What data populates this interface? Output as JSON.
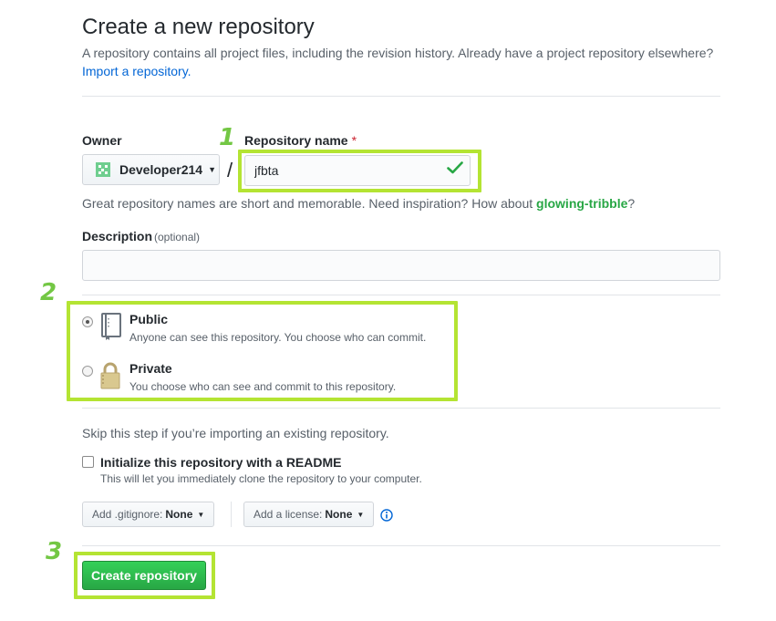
{
  "header": {
    "title": "Create a new repository",
    "subtitle": "A repository contains all project files, including the revision history. Already have a project repository elsewhere?",
    "import_link": "Import a repository."
  },
  "owner": {
    "label": "Owner",
    "value": "Developer214"
  },
  "repo_name": {
    "label": "Repository name",
    "required_mark": "*",
    "separator": "/",
    "value": "jfbta",
    "valid": true
  },
  "hint": {
    "prefix": "Great repository names are short and memorable. Need inspiration? How about ",
    "suggestion": "glowing-tribble",
    "suffix": "?"
  },
  "description": {
    "label": "Description",
    "optional": "(optional)",
    "value": ""
  },
  "visibility": {
    "selected": "public",
    "options": [
      {
        "id": "public",
        "title": "Public",
        "desc": "Anyone can see this repository. You choose who can commit.",
        "icon": "book-icon"
      },
      {
        "id": "private",
        "title": "Private",
        "desc": "You choose who can see and commit to this repository.",
        "icon": "lock-icon"
      }
    ]
  },
  "init": {
    "skip_note": "Skip this step if you’re importing an existing repository.",
    "readme_label": "Initialize this repository with a README",
    "readme_desc": "This will let you immediately clone the repository to your computer.",
    "readme_checked": false
  },
  "gitignore": {
    "label": "Add .gitignore:",
    "value": "None"
  },
  "license": {
    "label": "Add a license:",
    "value": "None"
  },
  "info_icon": "info-icon",
  "submit": {
    "label": "Create repository"
  },
  "annotations": [
    "1",
    "2",
    "3"
  ],
  "colors": {
    "highlight": "#b4e433",
    "annotation": "#73c744",
    "primary_button": "#28a745",
    "link": "#0366d6"
  }
}
